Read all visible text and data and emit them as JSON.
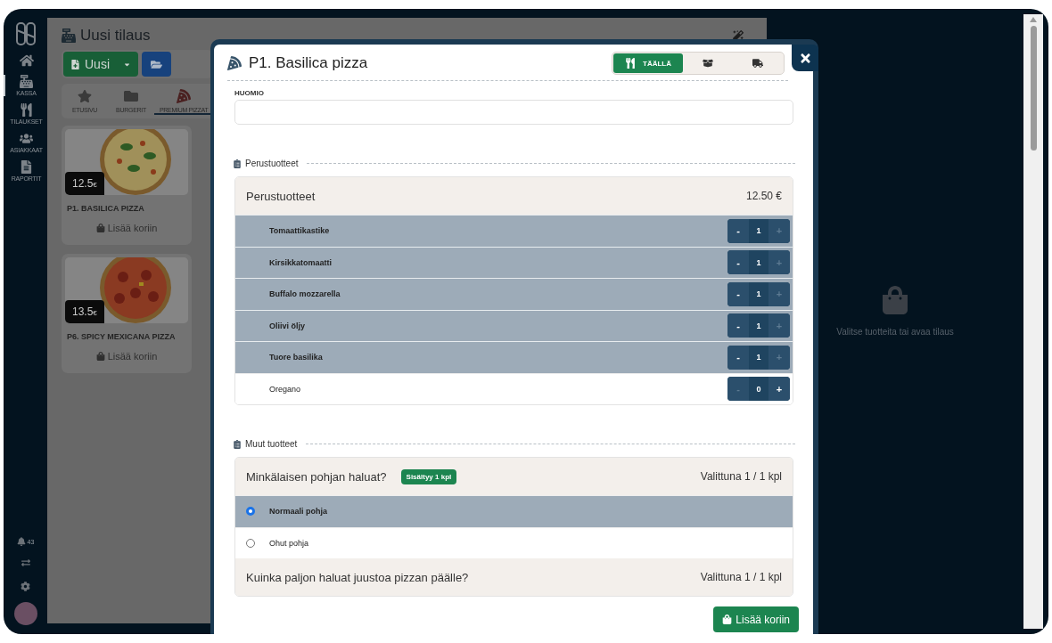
{
  "sidebar": {
    "items": [
      {
        "kind": "home",
        "selected": false
      },
      {
        "kind": "register",
        "label": "KASSA",
        "selected": true
      },
      {
        "kind": "orders",
        "label": "TILAUKSET",
        "selected": false
      },
      {
        "kind": "customers",
        "label": "ASIAKKAAT",
        "selected": false
      },
      {
        "kind": "reports",
        "label": "RAPORTIT",
        "selected": false
      }
    ],
    "notifications": "43"
  },
  "page": {
    "title": "Uusi tilaus",
    "new_button": "Uusi",
    "categories": [
      {
        "kind": "star",
        "label": "ETUSIVU",
        "selected": false
      },
      {
        "kind": "folder",
        "label": "BURGERIT",
        "selected": false
      },
      {
        "kind": "pizza",
        "label": "PREMIUM PIZZAT",
        "selected": true
      }
    ],
    "products": [
      {
        "name": "P1. BASILICA PIZZA",
        "price": "12.5",
        "currency": "€",
        "action": "Lisää koriin",
        "kind": "margherita"
      },
      {
        "name": "P6. SPICY MEXICANA PIZZA",
        "price": "13.5",
        "currency": "€",
        "action": "Lisää koriin",
        "kind": "pepperoni"
      }
    ]
  },
  "dialog": {
    "title": "P1. Basilica pizza",
    "modes": [
      {
        "kind": "dine_in",
        "label": "TÄÄLLÄ",
        "selected": true
      },
      {
        "kind": "takeaway",
        "selected": false
      },
      {
        "kind": "delivery",
        "selected": false
      }
    ],
    "note": {
      "label": "HUOMIO"
    },
    "base_section": {
      "title": "Perustuotteet",
      "header": "Perustuotteet",
      "price": "12.50 €",
      "items": [
        {
          "name": "Tomaattikastike",
          "minus": "-",
          "plus": "+",
          "quantity": "1",
          "selected": true,
          "minus_disabled": false,
          "plus_disabled": true
        },
        {
          "name": "Kirsikkatomaatti",
          "minus": "-",
          "plus": "+",
          "quantity": "1",
          "selected": true,
          "minus_disabled": false,
          "plus_disabled": true
        },
        {
          "name": "Buffalo mozzarella",
          "minus": "-",
          "plus": "+",
          "quantity": "1",
          "selected": true,
          "minus_disabled": false,
          "plus_disabled": true
        },
        {
          "name": "Oliivi öljy",
          "minus": "-",
          "plus": "+",
          "quantity": "1",
          "selected": true,
          "minus_disabled": false,
          "plus_disabled": true
        },
        {
          "name": "Tuore basilika",
          "minus": "-",
          "plus": "+",
          "quantity": "1",
          "selected": true,
          "minus_disabled": false,
          "plus_disabled": true
        },
        {
          "name": "Oregano",
          "minus": "-",
          "plus": "+",
          "quantity": "0",
          "selected": false,
          "minus_disabled": true,
          "plus_disabled": false
        }
      ]
    },
    "other_section": {
      "title": "Muut tuotteet",
      "groups": [
        {
          "question": "Minkälaisen pohjan haluat?",
          "badge": "Sisältyy 1 kpl",
          "count": "Valittuna 1 / 1 kpl",
          "options": [
            {
              "name": "Normaali pohja",
              "selected": true
            },
            {
              "name": "Ohut pohja",
              "selected": false
            }
          ]
        },
        {
          "question": "Kuinka paljon haluat juustoa pizzan päälle?",
          "count": "Valittuna 1 / 1 kpl"
        }
      ]
    },
    "add_button": "Lisää koriin"
  },
  "cart": {
    "empty_text": "Valitse tuotteita tai avaa tilaus"
  }
}
